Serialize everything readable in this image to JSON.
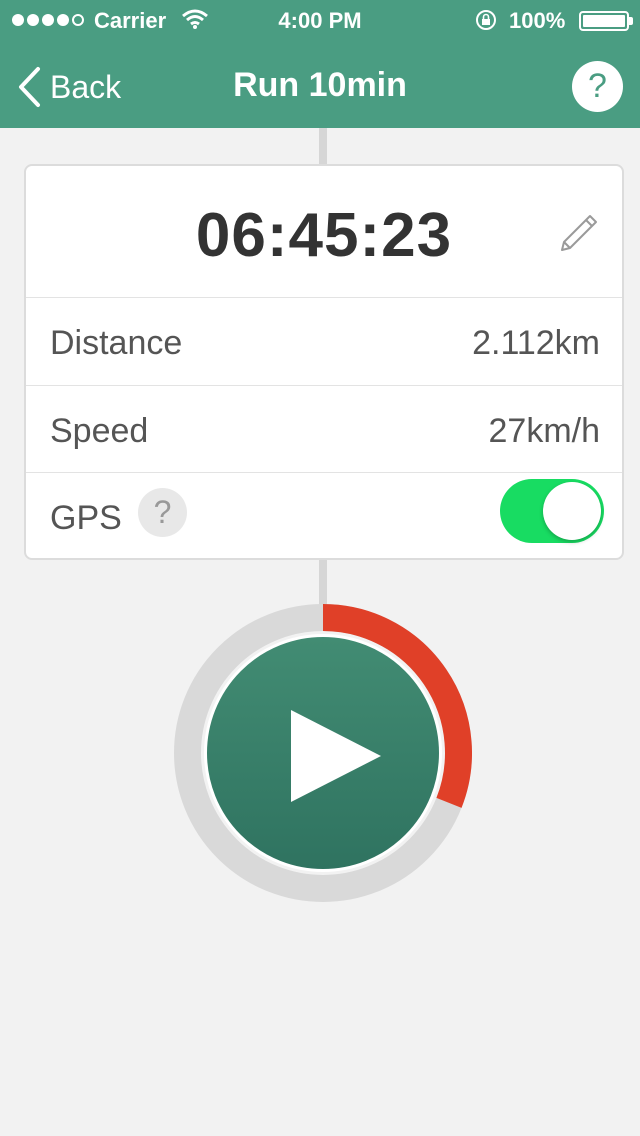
{
  "status_bar": {
    "carrier": "Carrier",
    "time": "4:00 PM",
    "battery": "100%"
  },
  "nav": {
    "back_label": "Back",
    "title": "Run 10min",
    "help_label": "?"
  },
  "timer": {
    "value": "06:45:23"
  },
  "stats": [
    {
      "label": "Distance",
      "value": "2.112km"
    },
    {
      "label": "Speed",
      "value": "27km/h"
    }
  ],
  "gps": {
    "label": "GPS",
    "help_label": "?",
    "enabled": true
  },
  "workout": {
    "progress_fraction": 0.31
  },
  "colors": {
    "header": "#4a9d82",
    "toggle_on": "#18dc62",
    "progress": "#e04028",
    "track": "#d9d9d9",
    "play": "#3a8069"
  },
  "icons": {
    "back": "chevron-left-icon",
    "edit": "pencil-icon",
    "play": "play-icon"
  }
}
